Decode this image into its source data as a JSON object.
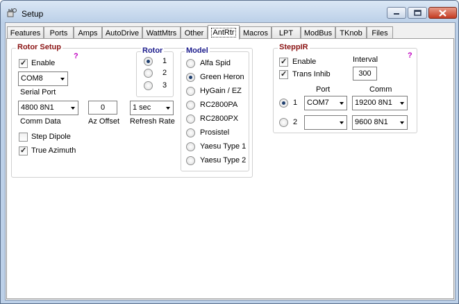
{
  "window": {
    "title": "Setup"
  },
  "tabs": [
    "Features",
    "Ports",
    "Amps",
    "AutoDrive",
    "WattMtrs",
    "Other",
    "AntRtr",
    "Macros",
    "LPT",
    "ModBus",
    "TKnob",
    "Files"
  ],
  "rotor_setup": {
    "title": "Rotor Setup",
    "help": "?",
    "enable_label": "Enable",
    "enable_checked": true,
    "serial_port_value": "COM8",
    "serial_port_label": "Serial Port",
    "comm_data_value": "4800 8N1",
    "comm_data_label": "Comm Data",
    "az_offset_value": "0",
    "az_offset_label": "Az Offset",
    "refresh_rate_value": "1 sec",
    "refresh_rate_label": "Refresh Rate",
    "step_dipole_label": "Step Dipole",
    "step_dipole_checked": false,
    "true_azimuth_label": "True Azimuth",
    "true_azimuth_checked": true
  },
  "rotor": {
    "title": "Rotor",
    "options": [
      "1",
      "2",
      "3"
    ],
    "selected": "1"
  },
  "model": {
    "title": "Model",
    "options": [
      "Alfa Spid",
      "Green Heron",
      "HyGain / EZ",
      "RC2800PA",
      "RC2800PX",
      "Prosistel",
      "Yaesu Type 1",
      "Yaesu Type 2"
    ],
    "selected": "Green Heron"
  },
  "steppir": {
    "title": "SteppIR",
    "help": "?",
    "enable_label": "Enable",
    "enable_checked": true,
    "trans_inhib_label": "Trans Inhib",
    "trans_inhib_checked": true,
    "interval_label": "Interval",
    "interval_value": "300",
    "port_header": "Port",
    "comm_header": "Comm",
    "row1_label": "1",
    "row1_port": "COM7",
    "row1_comm": "19200 8N1",
    "row2_label": "2",
    "row2_port": "",
    "row2_comm": "9600 8N1",
    "selected_row": "1"
  },
  "colors": {
    "rotor_setup_title": "#8b1414",
    "model_title": "#1c1c8c",
    "help_mark": "#c000c0"
  }
}
